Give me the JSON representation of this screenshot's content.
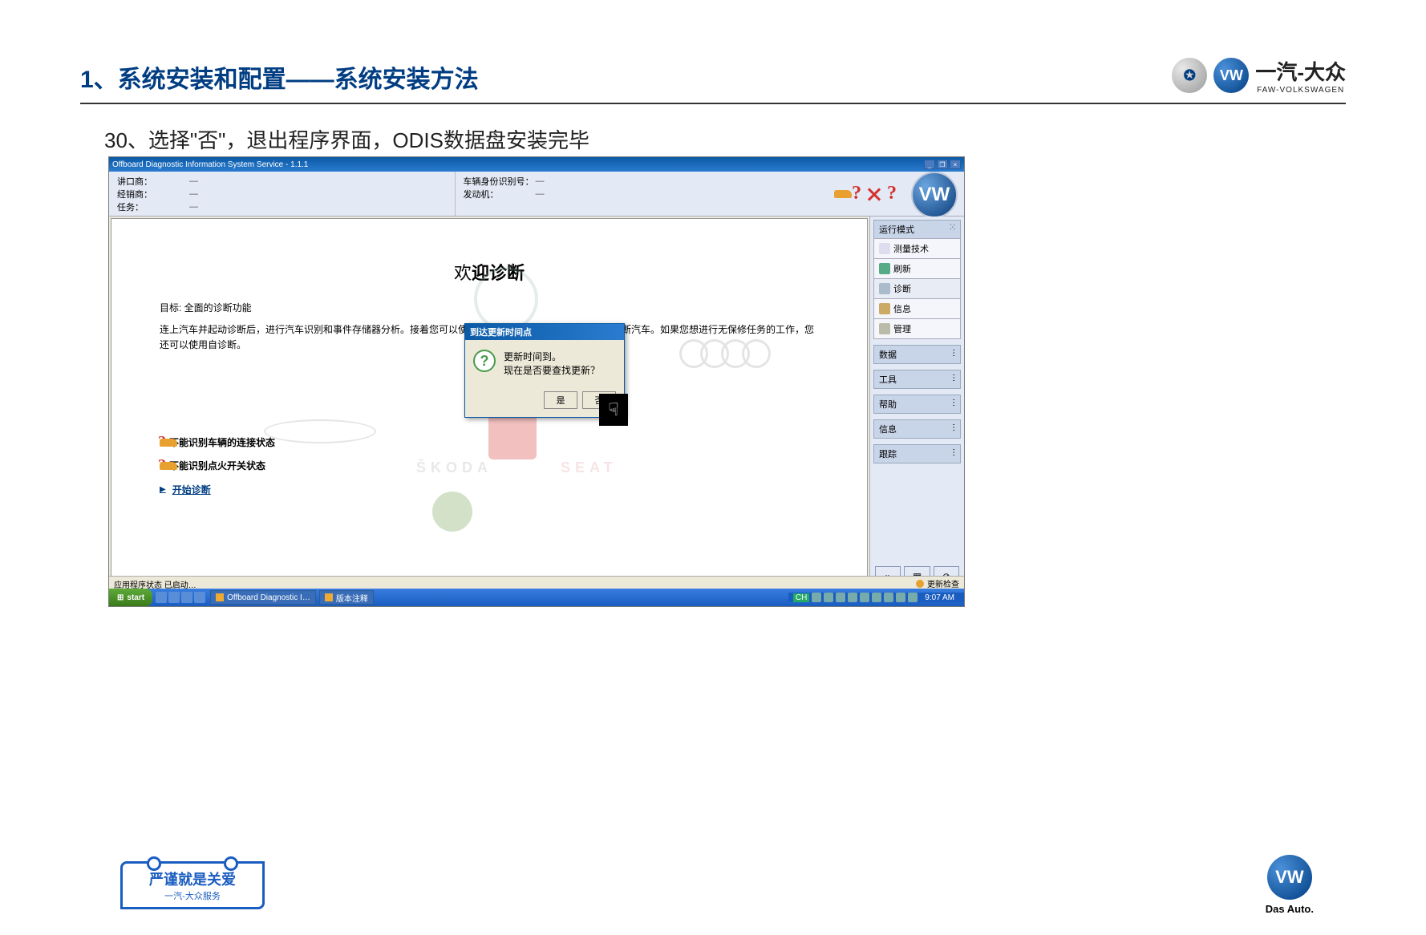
{
  "slide": {
    "title": "1、系统安装和配置——系统安装方法",
    "step_text": "30、选择\"否\"，退出程序界面，ODIS数据盘安装完毕",
    "faw_brand_cn": "一汽-大众",
    "faw_brand_en": "FAW-VOLKSWAGEN"
  },
  "odis": {
    "window_title": "Offboard Diagnostic Information System Service - 1.1.1",
    "info": {
      "importer_label": "讲口商：",
      "importer_value": "—",
      "dealer_label": "经销商：",
      "dealer_value": "—",
      "task_label": "任务：",
      "task_value": "—",
      "vin_label": "车辆身份识别号：",
      "vin_value": "—",
      "engine_label": "发动机：",
      "engine_value": "—"
    },
    "welcome": {
      "title_pre": "欢",
      "title_bold": "迎诊断",
      "target": "目标: 全面的诊断功能",
      "desc": "连上汽车并起动诊断后，进行汽车识别和事件存储器分析。接着您可以使用引导型故障查询功能和引导功能诊断汽车。如果您想进行无保修任务的工作，您还可以使用自诊断。",
      "status1": "不能识别车辆的连接状态",
      "status2": "不能识别点火开关状态",
      "start_link": "开始诊断"
    },
    "sidebar": {
      "mode_header": "运行模式",
      "items": [
        "测量技术",
        "刷新",
        "诊断",
        "信息",
        "管理"
      ],
      "collapsed": [
        "数据",
        "工具",
        "帮助",
        "信息",
        "跟踪"
      ]
    },
    "dialog": {
      "title": "到达更新时间点",
      "line1": "更新时间到。",
      "line2": "现在是否要查找更新？",
      "yes": "是",
      "no": "否"
    },
    "status_bar": "应用程序状态 已启动…",
    "status_bar_right": "更新检查"
  },
  "taskbar": {
    "start": "start",
    "item1": "Offboard Diagnostic I…",
    "item2": "版本注释",
    "clock": "9:07 AM"
  },
  "footer": {
    "care_main": "严谨就是关爱",
    "care_sub": "一汽-大众服务",
    "das_auto": "Das Auto."
  }
}
